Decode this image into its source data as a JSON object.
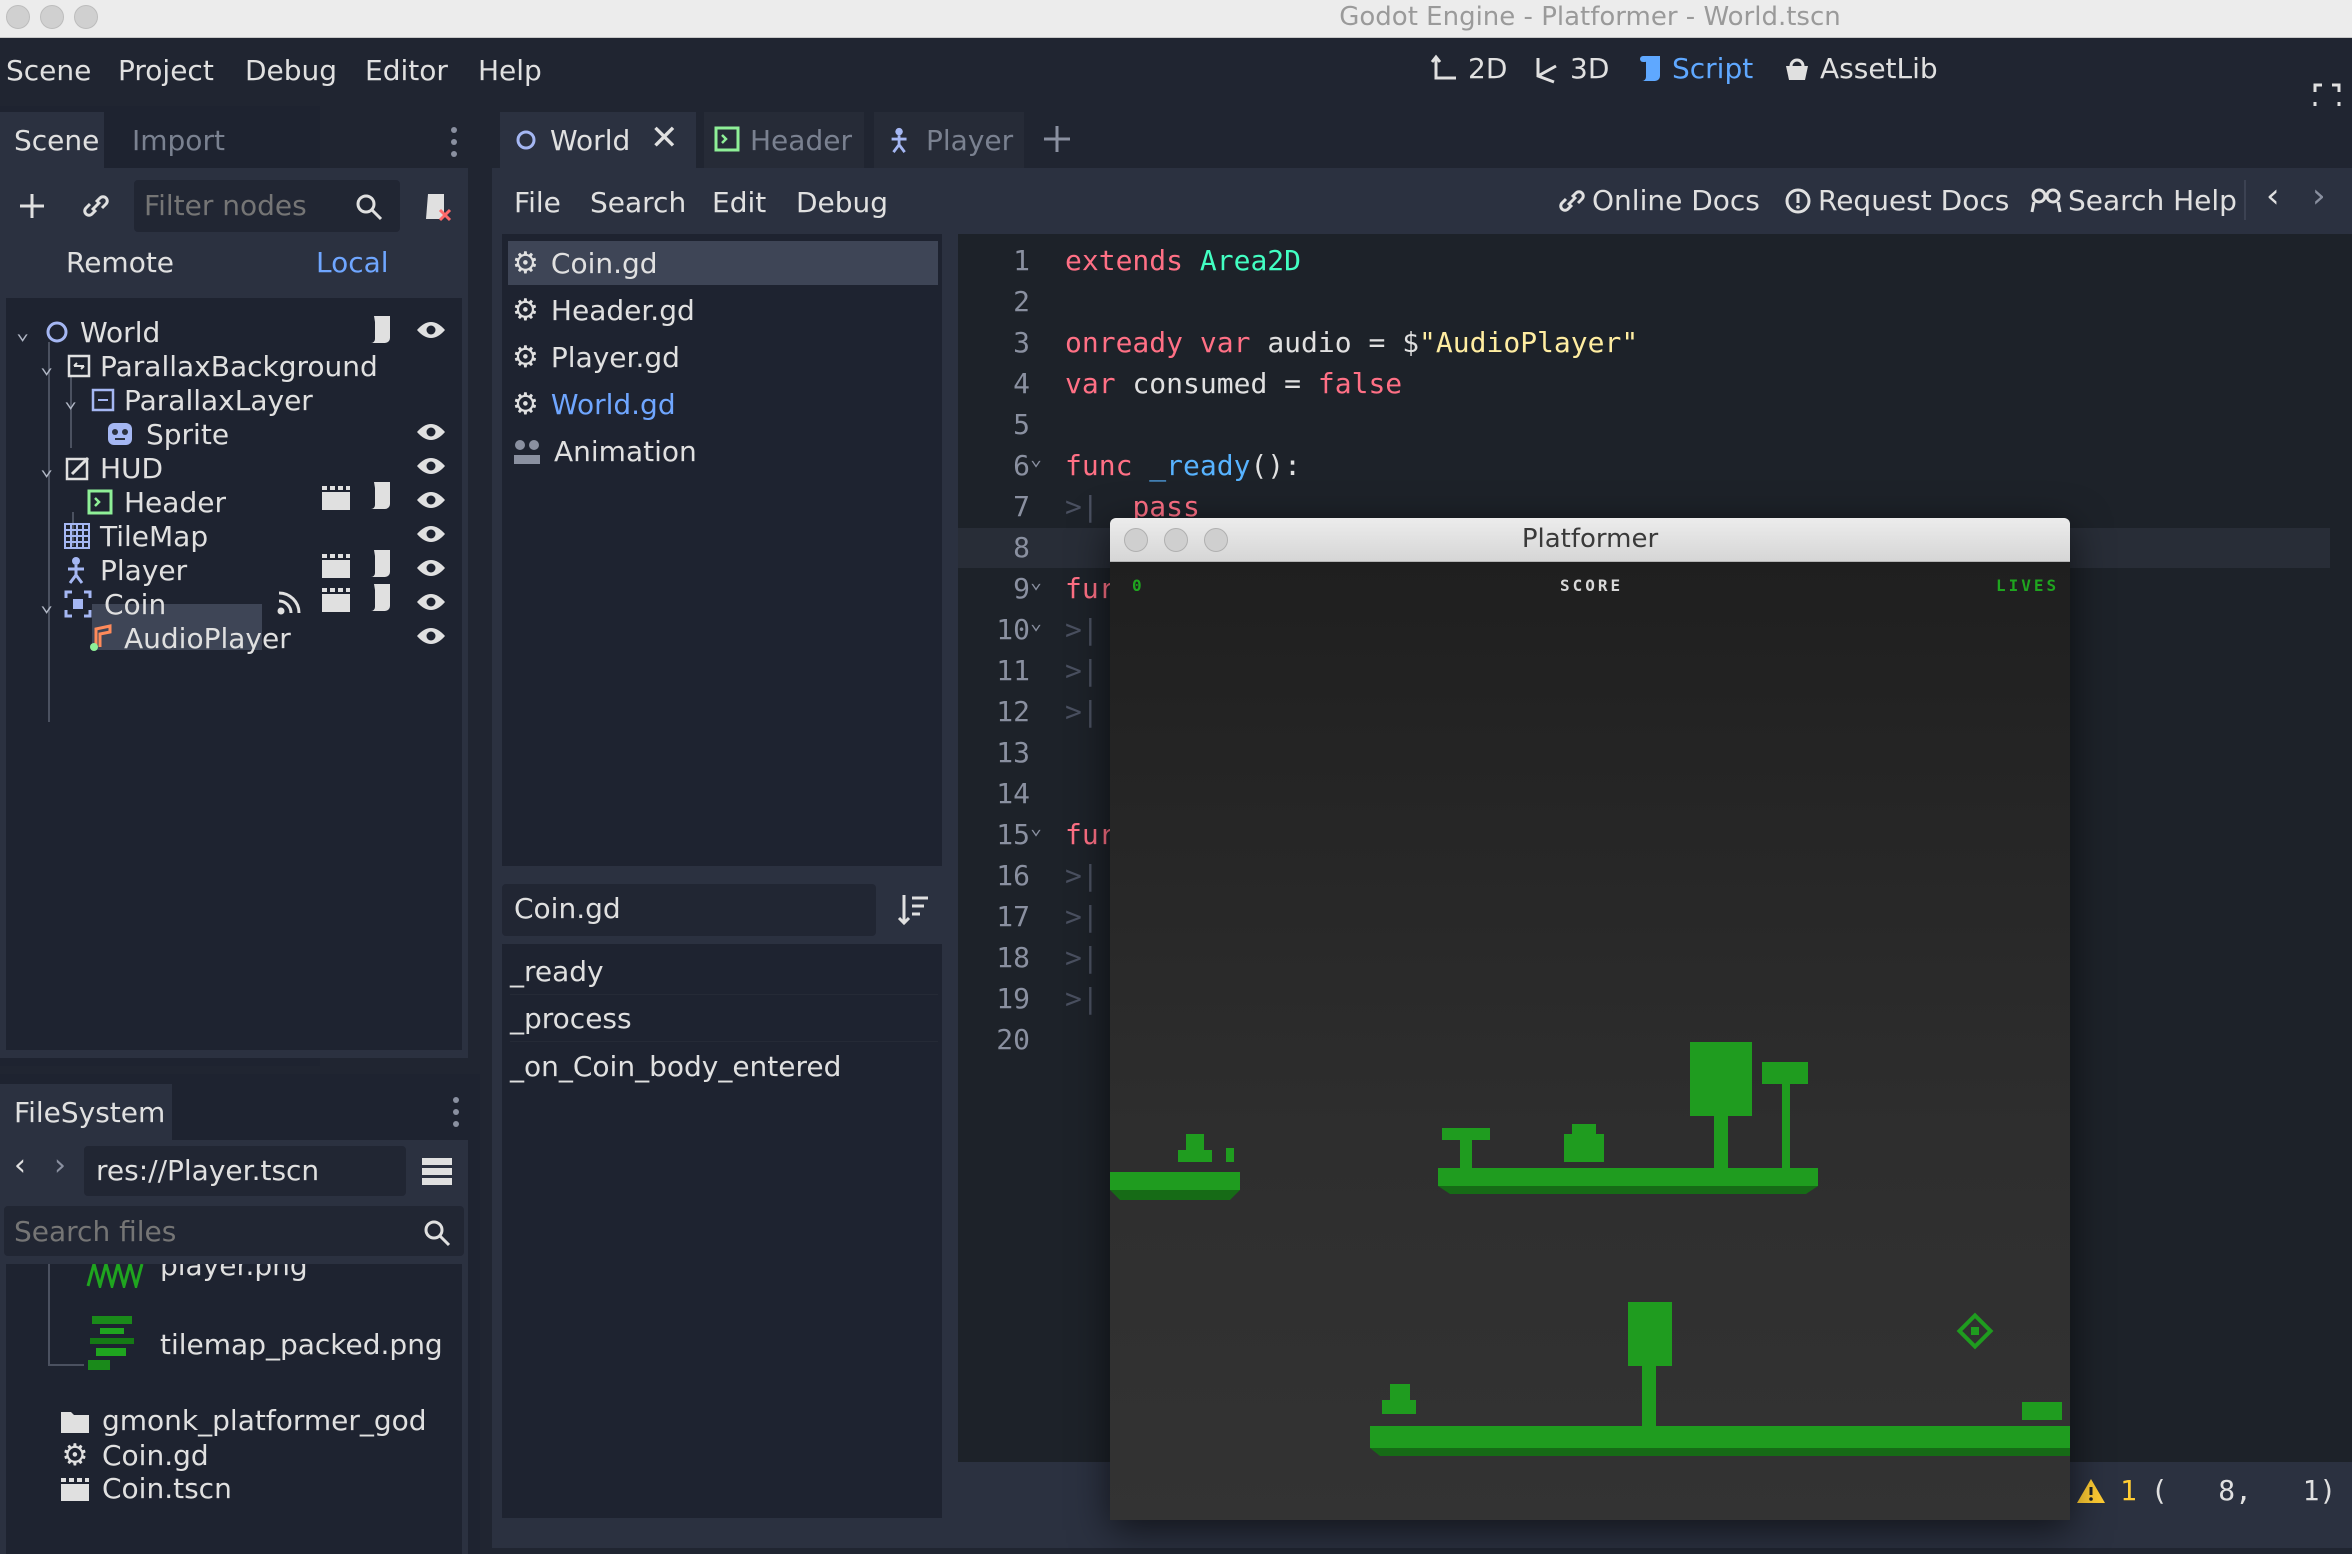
{
  "window": {
    "title": "Godot Engine - Platformer - World.tscn"
  },
  "menubar": {
    "menus": [
      "Scene",
      "Project",
      "Debug",
      "Editor",
      "Help"
    ],
    "workspaces": [
      "2D",
      "3D",
      "Script",
      "AssetLib"
    ],
    "active_workspace": "Script"
  },
  "scene_dock": {
    "tabs": [
      "Scene",
      "Import"
    ],
    "filter_placeholder": "Filter nodes",
    "remote_label": "Remote",
    "local_label": "Local",
    "nodes": [
      "World",
      "ParallaxBackground",
      "ParallaxLayer",
      "Sprite",
      "HUD",
      "Header",
      "TileMap",
      "Player",
      "Coin",
      "AudioPlayer"
    ]
  },
  "filesystem_dock": {
    "tab": "FileSystem",
    "path": "res://Player.tscn",
    "search_placeholder": "Search files",
    "items": [
      "player.png",
      "tilemap_packed.png",
      "gmonk_platformer_god",
      "Coin.gd",
      "Coin.tscn"
    ]
  },
  "scene_tabs": [
    "World",
    "Header",
    "Player"
  ],
  "script_editor": {
    "menus": [
      "File",
      "Search",
      "Edit",
      "Debug"
    ],
    "help_buttons": [
      "Online Docs",
      "Request Docs",
      "Search Help"
    ],
    "scripts": [
      "Coin.gd",
      "Header.gd",
      "Player.gd",
      "World.gd",
      "Animation"
    ],
    "current_script_field": "Coin.gd",
    "methods": [
      "_ready",
      "_process",
      "_on_Coin_body_entered"
    ],
    "line_numbers": [
      "1",
      "2",
      "3",
      "4",
      "5",
      "6",
      "7",
      "8",
      "9",
      "10",
      "11",
      "12",
      "13",
      "14",
      "15",
      "16",
      "17",
      "18",
      "19",
      "20"
    ],
    "code": {
      "l1_kw": "extends",
      "l1_cls": "Area2D",
      "l3_kw1": "onready",
      "l3_kw2": "var",
      "l3_name": "audio",
      "l3_op": "=",
      "l3_dollar": "$",
      "l3_str": "\"AudioPlayer\"",
      "l4_kw": "var",
      "l4_name": "consumed",
      "l4_op": "=",
      "l4_val": "false",
      "l6_kw": "func",
      "l6_fn": "_ready",
      "l6_rest": "():",
      "l7_kw": "pass",
      "l9_partial": "fur",
      "l15_partial": "fur"
    },
    "status": {
      "warnings": "1",
      "position": "(   8,   1)"
    }
  },
  "game_window": {
    "title": "Platformer",
    "hud_score_value": "0",
    "hud_score_label": "SCORE",
    "hud_lives_label": "LIVES"
  },
  "colors": {
    "accent": "#5fa8ff",
    "keyword": "#ff7085",
    "class": "#42ffc2",
    "string": "#ffeda1",
    "function": "#57b3ff",
    "game_green": "#1f9c1f"
  }
}
